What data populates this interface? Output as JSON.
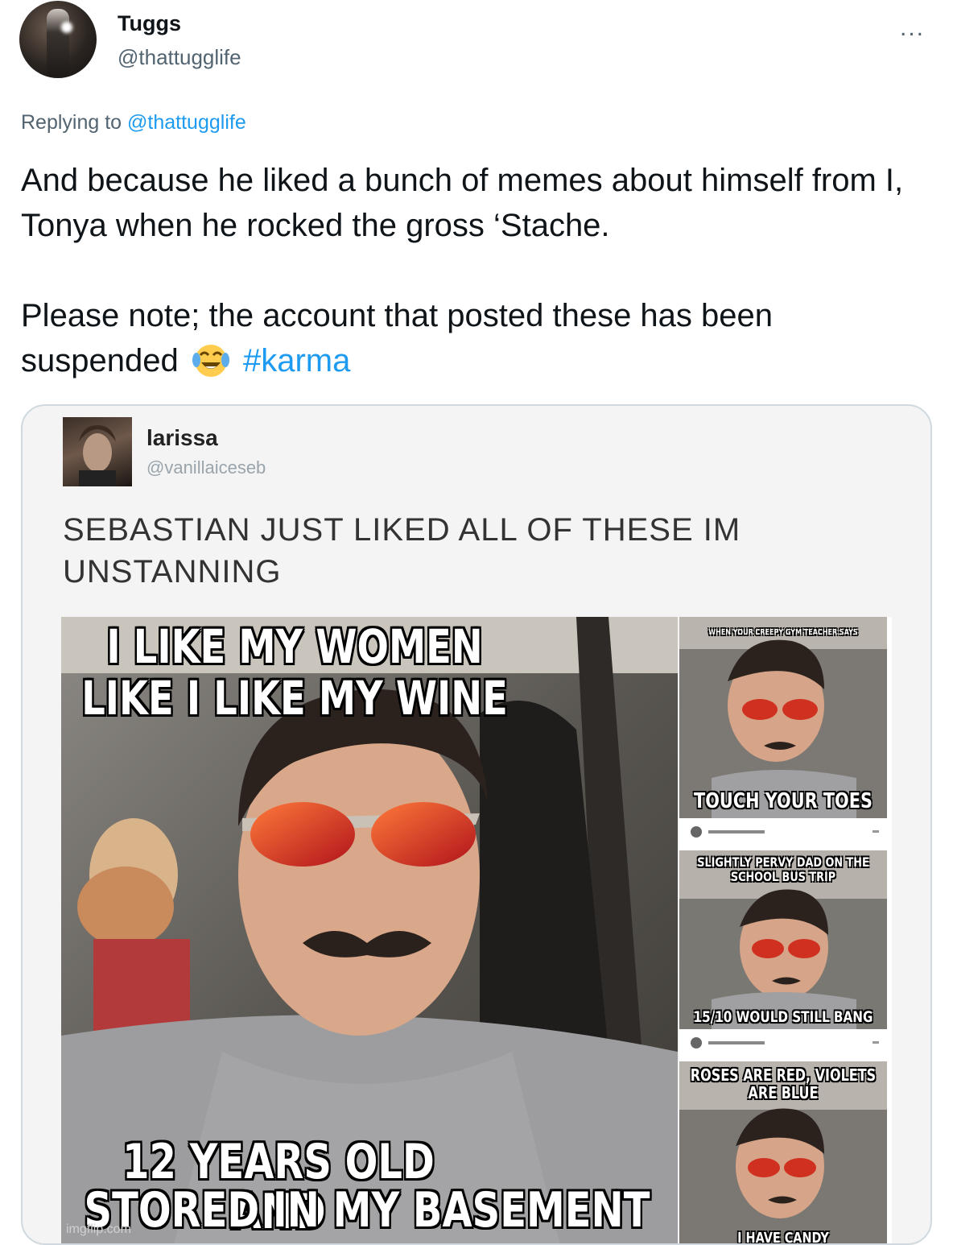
{
  "author": {
    "display_name": "Tuggs",
    "handle": "@thattugglife"
  },
  "more_label": "...",
  "reply_context": {
    "prefix": "Replying to",
    "target": "@thattugglife"
  },
  "tweet": {
    "line1": "And because he liked a bunch of memes about himself from I, Tonya when he rocked the gross ‘Stache.",
    "line2_text": "Please note; the account that posted these has been suspended",
    "emoji_icon": "face-with-tears-of-joy-icon",
    "hashtag": "#karma"
  },
  "embedded": {
    "name": "larissa",
    "handle": "@vanillaiceseb",
    "text": "SEBASTIAN JUST LIKED ALL OF THESE IM UNSTANNING",
    "main_meme": {
      "top_line1": "I LIKE MY WOMEN",
      "top_line2": "LIKE I LIKE MY WINE",
      "bottom_line1": "12 YEARS OLD AND",
      "bottom_line2": "STORED IN MY BASEMENT",
      "watermark": "imgflip.com"
    },
    "side_memes": [
      {
        "top": "WHEN YOUR CREEPY GYM TEACHER SAYS",
        "bottom": "TOUCH YOUR TOES"
      },
      {
        "top": "SLIGHTLY PERVY DAD ON THE SCHOOL BUS TRIP",
        "bottom": "15/10 WOULD STILL BANG"
      },
      {
        "top": "ROSES ARE RED, VIOLETS ARE BLUE",
        "bottom": "I HAVE CANDY"
      }
    ]
  },
  "colors": {
    "link": "#1d9bf0",
    "secondary_text": "#536471",
    "card_border": "#cfd9de"
  }
}
